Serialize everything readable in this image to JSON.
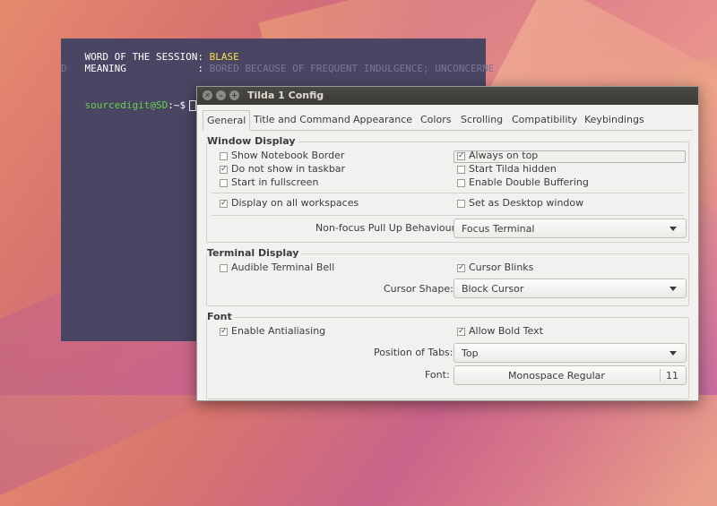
{
  "terminal": {
    "word_label": "WORD OF THE SESSION: ",
    "word_value": "BLASE",
    "meaning_label": "MEANING            : ",
    "meaning_value": "BORED BECAUSE OF FREQUENT INDULGENCE; UNCONCERNE",
    "meaning_wrap": "D",
    "prompt_user": "sourcedigit@SD",
    "prompt_rest": ":~$"
  },
  "window": {
    "title": "Tilda 1 Config",
    "close_glyph": "✕",
    "minimize_glyph": "–",
    "maximize_glyph": "+"
  },
  "tabs": [
    "General",
    "Title and Command",
    "Appearance",
    "Colors",
    "Scrolling",
    "Compatibility",
    "Keybindings"
  ],
  "window_display": {
    "title": "Window Display",
    "show_notebook_border": {
      "label": "Show Notebook Border",
      "checked": false
    },
    "always_on_top": {
      "label": "Always on top",
      "checked": true
    },
    "do_not_show_taskbar": {
      "label": "Do not show in taskbar",
      "checked": true
    },
    "start_hidden": {
      "label": "Start Tilda hidden",
      "checked": false
    },
    "start_fullscreen": {
      "label": "Start in fullscreen",
      "checked": false
    },
    "double_buffering": {
      "label": "Enable Double Buffering",
      "checked": false
    },
    "all_workspaces": {
      "label": "Display on all workspaces",
      "checked": true
    },
    "desktop_window": {
      "label": "Set as Desktop window",
      "checked": false
    },
    "pull_up_label": "Non-focus Pull Up Behaviour:",
    "pull_up_value": "Focus Terminal"
  },
  "terminal_display": {
    "title": "Terminal Display",
    "audible_bell": {
      "label": "Audible Terminal Bell",
      "checked": false
    },
    "cursor_blinks": {
      "label": "Cursor Blinks",
      "checked": true
    },
    "cursor_shape_label": "Cursor Shape:",
    "cursor_shape_value": "Block Cursor"
  },
  "font": {
    "title": "Font",
    "antialiasing": {
      "label": "Enable Antialiasing",
      "checked": true
    },
    "bold_text": {
      "label": "Allow Bold Text",
      "checked": true
    },
    "tabs_position_label": "Position of Tabs:",
    "tabs_position_value": "Top",
    "font_label": "Font:",
    "font_name": "Monospace Regular",
    "font_size": "11"
  },
  "colors": {
    "terminal_bg": "#4a4563",
    "highlight_yellow": "#f5e146",
    "prompt_green": "#66d24a",
    "titlebar": "#3b3a36",
    "dialog_bg": "#f2f1ef"
  }
}
